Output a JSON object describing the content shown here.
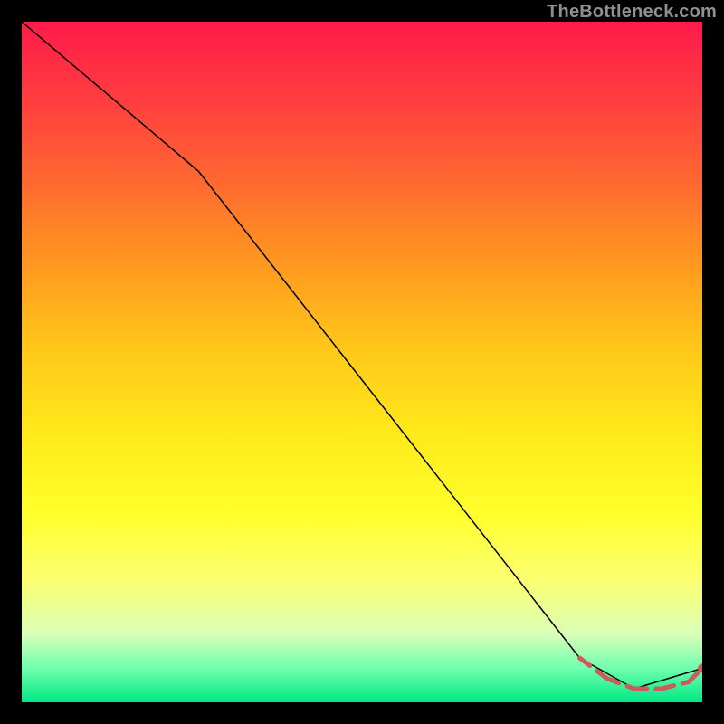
{
  "watermark": "TheBottleneck.com",
  "chart_data": {
    "type": "line",
    "title": "",
    "xlabel": "",
    "ylabel": "",
    "xlim": [
      0,
      100
    ],
    "ylim": [
      0,
      100
    ],
    "grid": false,
    "legend": false,
    "series": [
      {
        "name": "curve",
        "color": "#000000",
        "stroke_width": 1.5,
        "x": [
          0,
          26,
          82,
          90,
          100
        ],
        "y": [
          100,
          78,
          6.5,
          2,
          5
        ]
      },
      {
        "name": "highlight-dashes",
        "color": "#cf5a5a",
        "stroke_width": 5,
        "dashed": true,
        "x": [
          82,
          86,
          90,
          94,
          98,
          100
        ],
        "y": [
          6.5,
          3.5,
          2,
          2,
          3,
          5
        ]
      }
    ],
    "points": [
      {
        "x": 100,
        "y": 5,
        "r": 5,
        "color": "#cf5a5a",
        "name": "end-dot"
      }
    ],
    "background_gradient": {
      "stops": [
        {
          "pos": 0,
          "color": "#ff1a4b"
        },
        {
          "pos": 50,
          "color": "#ffe81a"
        },
        {
          "pos": 95,
          "color": "#6fffae"
        },
        {
          "pos": 100,
          "color": "#00e884"
        }
      ]
    }
  }
}
